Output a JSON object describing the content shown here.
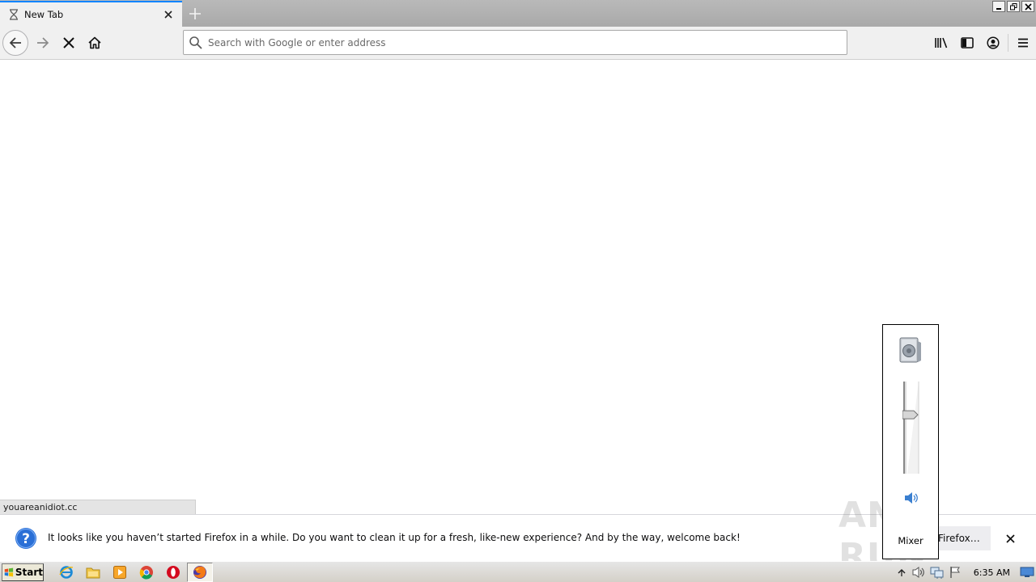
{
  "browser": {
    "tab": {
      "title": "New Tab",
      "icon": "hourglass-icon"
    },
    "urlbar": {
      "placeholder": "Search with Google or enter address",
      "value": ""
    },
    "status_url": "youareanidiot.cc"
  },
  "notification": {
    "message": "It looks like you haven’t started Firefox in a while. Do you want to clean it up for a fresh, like-new experience? And by the way, welcome back!",
    "action_label": "Firefox…"
  },
  "volume_popup": {
    "mixer_label": "Mixer",
    "volume_level": 0.65
  },
  "watermark": "ANY RUN",
  "taskbar": {
    "start_label": "Start",
    "apps": [
      "internet-explorer-icon",
      "file-explorer-icon",
      "media-player-icon",
      "chrome-icon",
      "opera-icon",
      "firefox-icon"
    ],
    "clock": "6:35 AM"
  },
  "colors": {
    "accent": "#0a84ff",
    "notification_icon": "#2a6fd6"
  }
}
